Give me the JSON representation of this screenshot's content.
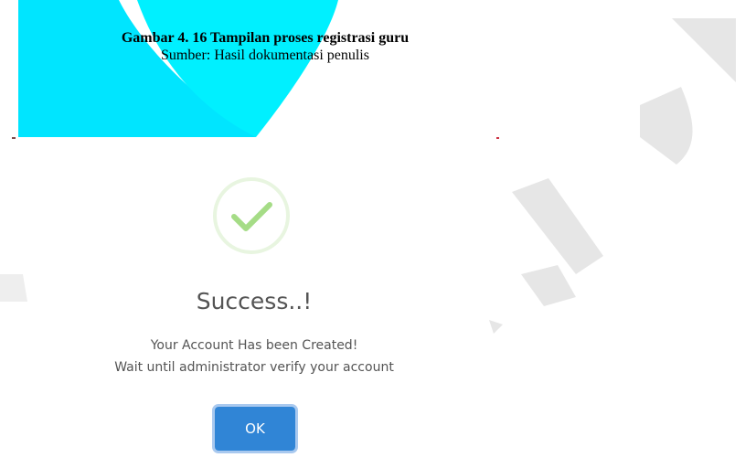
{
  "caption": {
    "title": "Gambar 4. 16 Tampilan proses registrasi guru",
    "source": "Sumber: Hasil dokumentasi penulis"
  },
  "dialog": {
    "icon": "success-check-icon",
    "title": "Success..!",
    "message_line1": "Your Account Has been Created!",
    "message_line2": "Wait until administrator verify your account",
    "ok_label": "OK"
  },
  "colors": {
    "success_ring": "#e8f5e0",
    "success_check": "#a5dc86",
    "button": "#3085d6",
    "button_focus_ring": "#a9c9ef",
    "text": "#545454",
    "watermark_cyan": "#00e5ff",
    "watermark_gray": "#e6e6e6"
  }
}
